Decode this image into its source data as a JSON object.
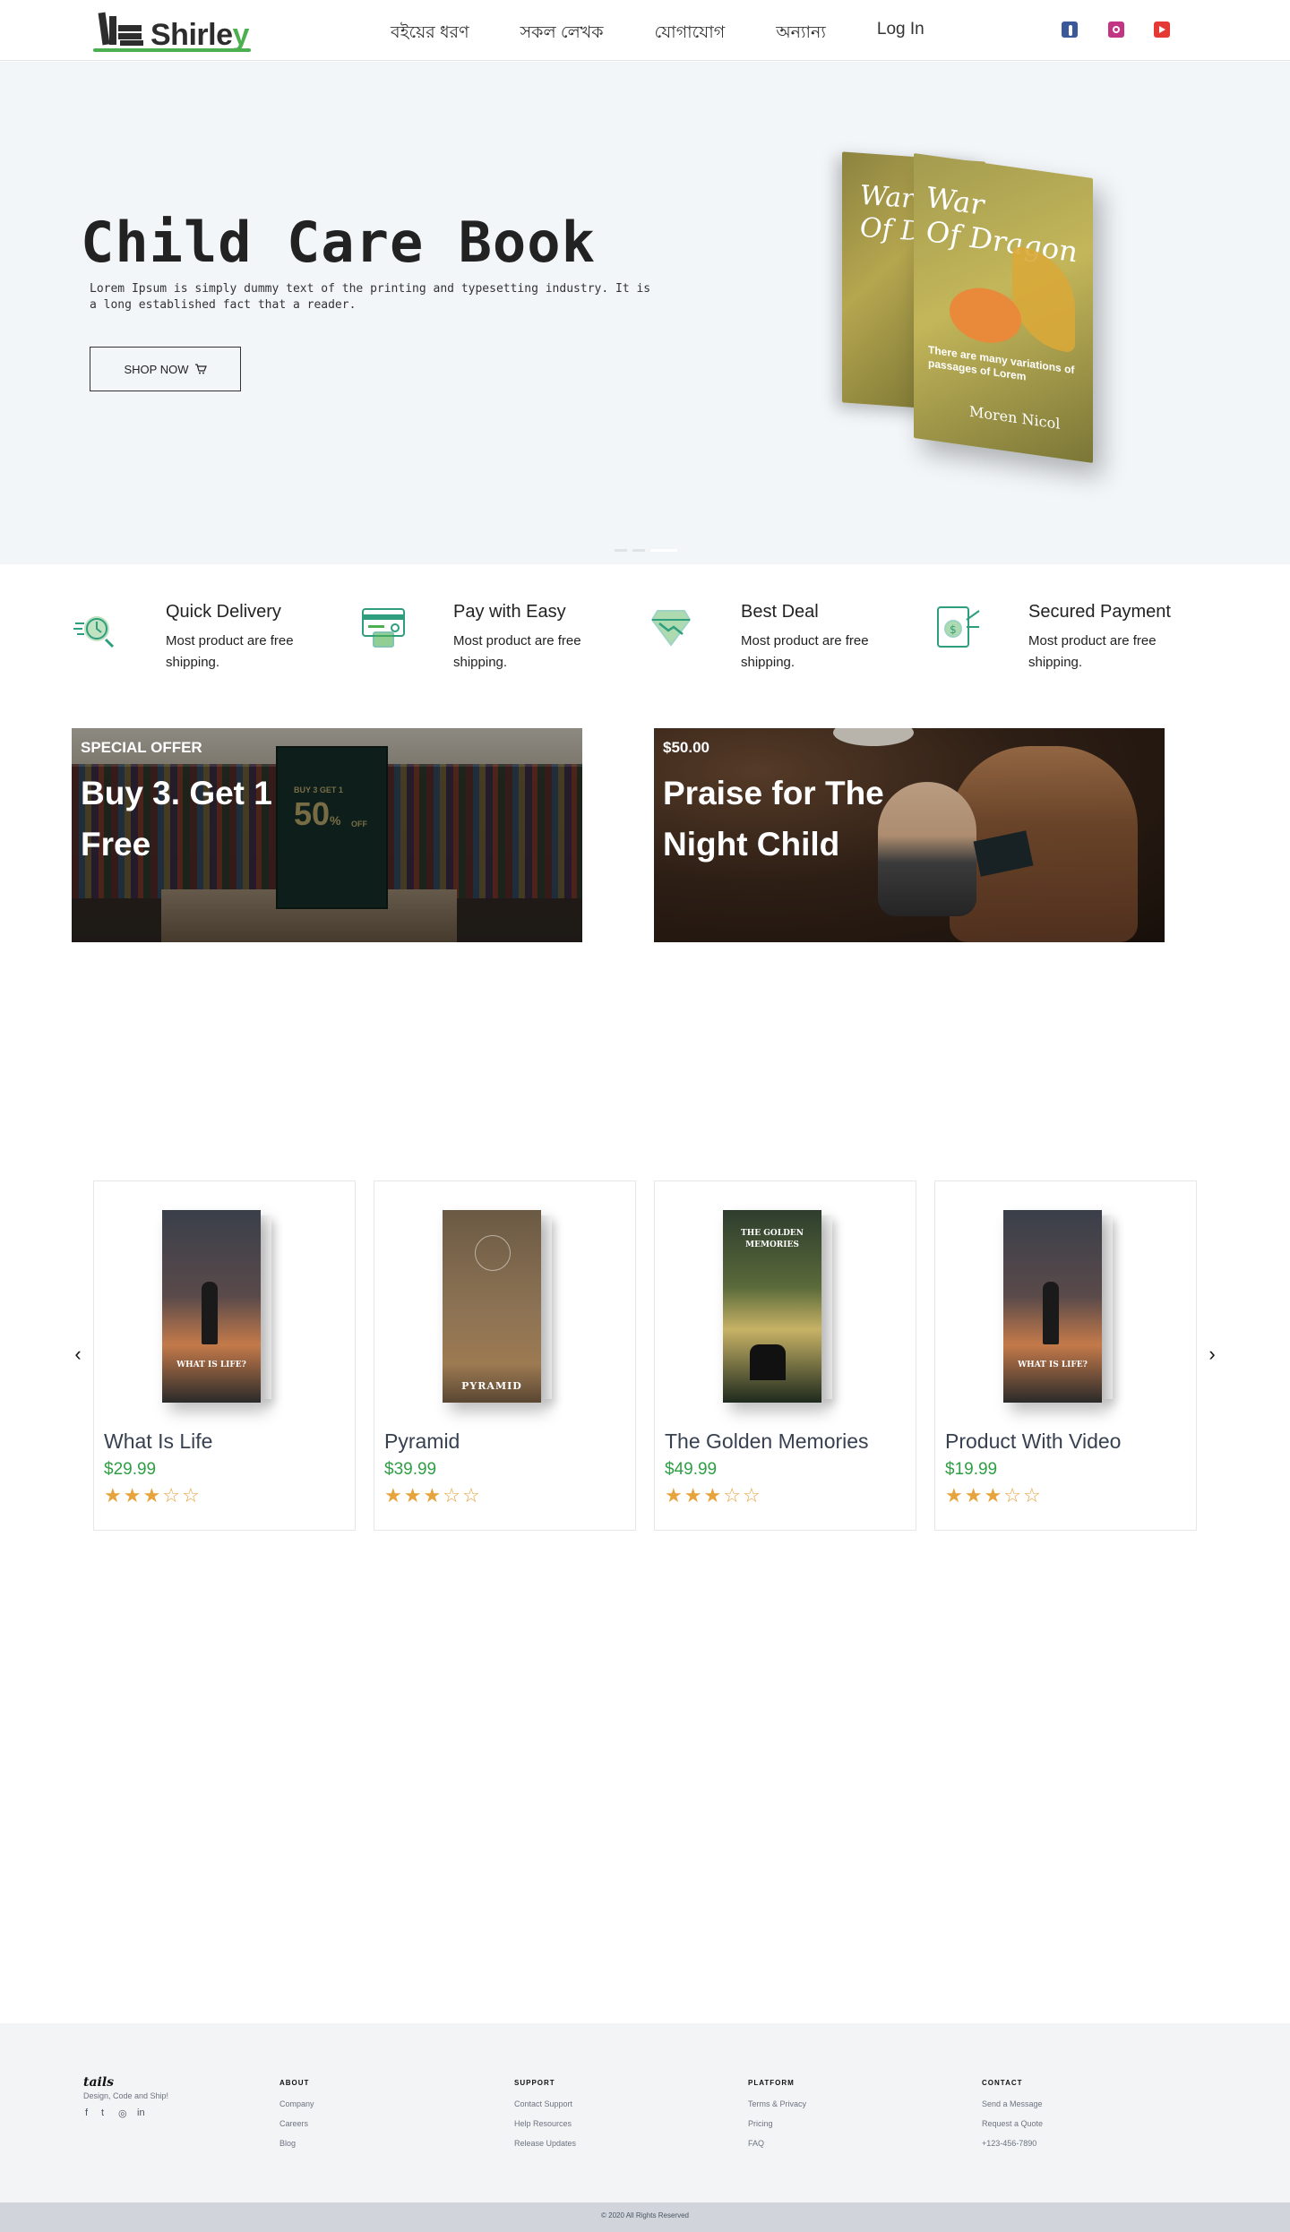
{
  "nav": {
    "logo_text_main": "Shirle",
    "logo_text_y": "y",
    "menu": [
      "বইয়ের ধরণ",
      "সকল লেখক",
      "যোগাযোগ",
      "অন্যান্য",
      "Log In"
    ],
    "social": [
      {
        "name": "facebook-icon",
        "color": "#3b5998"
      },
      {
        "name": "instagram-icon",
        "color": "#c13584"
      },
      {
        "name": "youtube-icon",
        "color": "#e53935"
      }
    ]
  },
  "hero": {
    "title": "Child Care Book",
    "text": "Lorem Ipsum is simply dummy text of the printing and typesetting industry. It is a long established fact that a reader.",
    "button_label": "SHOP NOW",
    "button_icon": "cart-icon",
    "book": {
      "title_line1": "War",
      "title_line2": "Of Dragon",
      "back_title_line1": "War",
      "back_title_line2": "Of D",
      "subtitle": "There are many variations of passages of Lorem",
      "author": "Moren Nicol"
    }
  },
  "features": [
    {
      "icon": "delivery-icon",
      "title": "Quick Delivery",
      "desc": "Most product are free shipping."
    },
    {
      "icon": "card-payment-icon",
      "title": "Pay with Easy",
      "desc": "Most product are free shipping."
    },
    {
      "icon": "deal-icon",
      "title": "Best Deal",
      "desc": "Most product are free shipping."
    },
    {
      "icon": "secure-payment-icon",
      "title": "Secured Payment",
      "desc": "Most product are free shipping."
    }
  ],
  "promos": [
    {
      "tag": "SPECIAL OFFER",
      "title": "Buy 3. Get 1 Free",
      "sign_top": "BUY 3 GET 1",
      "sign_big": "50",
      "sign_pct": "%",
      "sign_off": "OFF"
    },
    {
      "tag": "$50.00",
      "title": "Praise for The Night Child"
    }
  ],
  "products": [
    {
      "name": "What Is Life",
      "price": "$29.99",
      "rating": 3,
      "cover_title": "WHAT IS LIFE?",
      "cover_colors": [
        "#3a3f4a",
        "#c47a4a"
      ]
    },
    {
      "name": "Pyramid",
      "price": "$39.99",
      "rating": 3,
      "cover_title": "PYRAMID",
      "cover_colors": [
        "#6b5a44",
        "#9c7a52"
      ]
    },
    {
      "name": "The Golden Memories",
      "price": "$49.99",
      "rating": 3,
      "cover_title": "THE GOLDEN MEMORIES",
      "cover_colors": [
        "#2e3d2e",
        "#c7b265"
      ]
    },
    {
      "name": "Product With Video",
      "price": "$19.99",
      "rating": 3,
      "cover_title": "WHAT IS LIFE?",
      "cover_colors": [
        "#3a3f4a",
        "#c47a4a"
      ]
    }
  ],
  "carousel": {
    "prev": "‹",
    "next": "›"
  },
  "footer": {
    "logo": "tails",
    "tagline": "Design, Code and Ship!",
    "social": [
      "f",
      "t",
      "◎",
      "in"
    ],
    "columns": [
      {
        "heading": "ABOUT",
        "links": [
          "Company",
          "Careers",
          "Blog"
        ]
      },
      {
        "heading": "SUPPORT",
        "links": [
          "Contact Support",
          "Help Resources",
          "Release Updates"
        ]
      },
      {
        "heading": "PLATFORM",
        "links": [
          "Terms & Privacy",
          "Pricing",
          "FAQ"
        ]
      },
      {
        "heading": "CONTACT",
        "links": [
          "Send a Message",
          "Request a Quote",
          "+123-456-7890"
        ]
      }
    ],
    "copyright": "© 2020 All Rights Reserved"
  },
  "colors": {
    "accent_green": "#4caf50",
    "price_green": "#2f9e44",
    "star": "#e7a33c",
    "feature_icon": "#2e9e7e",
    "hero_bg": "#f2f6f9"
  }
}
